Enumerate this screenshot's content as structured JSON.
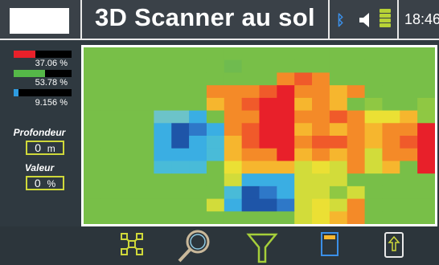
{
  "header": {
    "title": "3D Scanner au sol",
    "time": "18:46",
    "battery_level": 0.75,
    "bluetooth_icon": "bluetooth-icon",
    "speaker_icon": "speaker-icon",
    "signal_icon": "signal-strength-icon"
  },
  "sidebar": {
    "stats": [
      {
        "value": "37.06 %",
        "fraction": 0.37,
        "color": "#e8202a"
      },
      {
        "value": "53.78 %",
        "fraction": 0.54,
        "color": "#55b848"
      },
      {
        "value": "9.156 %",
        "fraction": 0.09,
        "color": "#2e9be0"
      }
    ],
    "depth_label": "Profondeur",
    "depth_value": "0",
    "depth_unit": "m",
    "value_label": "Valeur",
    "value_value": "0",
    "value_unit": "%"
  },
  "toolbar": {
    "icons": [
      "grid-view-icon",
      "magnifier-icon",
      "filter-icon",
      "sd-card-icon",
      "export-icon"
    ]
  },
  "palette": {
    "G": "#78bf48",
    "g": "#6fbb4f",
    "L": "#8fc843",
    "Y": "#d2dc3a",
    "y": "#ebe034",
    "o": "#f6b62e",
    "O": "#f48a28",
    "r": "#f05a2a",
    "R": "#e8202a",
    "c": "#6cc3c9",
    "b": "#3aaee3",
    "B": "#2e78c8",
    "D": "#1e55a8",
    "t": "#49bbd8"
  },
  "scan_grid": [
    "GGGGGGGGGGGGGGGGGGGG",
    "GGGGGGGGgGGGGGGGGGGG",
    "GGGGGGGGGGGOrOGGGGGG",
    "GGGGGGGOOOrROOoOGGGG",
    "GGGGGGGoOrRRoOoGLGGL",
    "GGGGccbGOORROOrOyyoL",
    "GGGGbDBbOrRRoOoOoOOR",
    "GGGGbDbtorRROrrOoOrR",
    "GGGGbbbtoOORoOoOYOOR",
    "GGGGtttGyoooYyYOYoGR",
    "GGGGGGGGYbbbYYYGGGGG",
    "GGGGGGGGtDBbYYLYGGGG",
    "GGGGGGGYbDDBYyYOGGGG",
    "GGGGGGGGGGGGYyoOGGGG"
  ]
}
